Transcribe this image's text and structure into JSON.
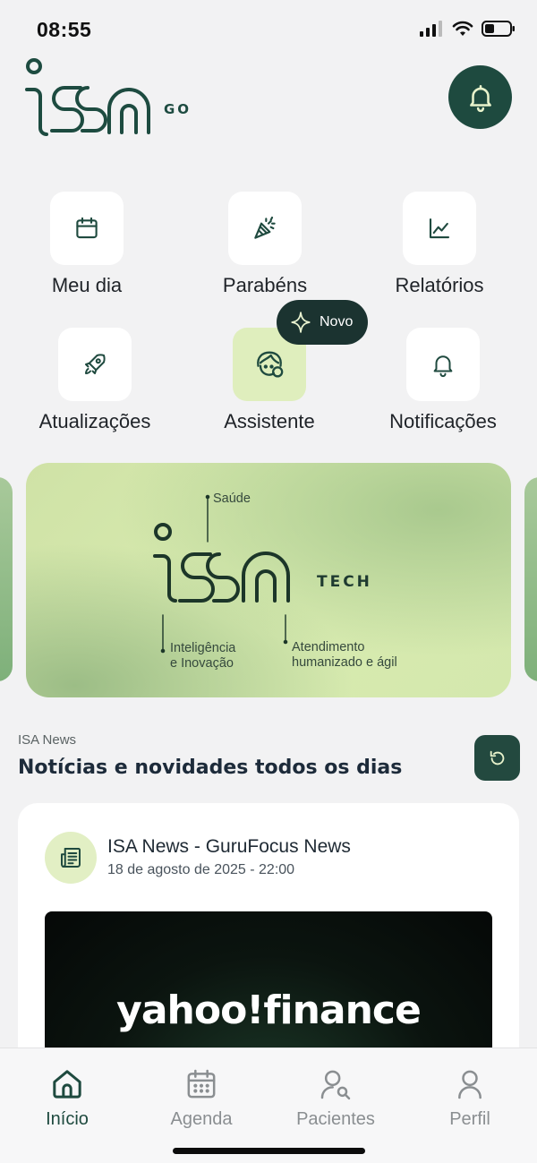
{
  "status_bar": {
    "time": "08:55"
  },
  "header": {
    "logo_text": "ISA",
    "logo_sub": "GO",
    "bell_icon": "bell-icon"
  },
  "shortcuts": [
    {
      "label": "Meu dia",
      "icon": "calendar-icon"
    },
    {
      "label": "Parabéns",
      "icon": "party-popper-icon"
    },
    {
      "label": "Relatórios",
      "icon": "chart-line-icon"
    },
    {
      "label": "Atualizações",
      "icon": "rocket-icon"
    },
    {
      "label": "Assistente",
      "icon": "assistant-face-icon"
    },
    {
      "label": "Notificações",
      "icon": "bell-icon"
    }
  ],
  "novo_badge": {
    "label": "Novo",
    "icon": "sparkle-icon"
  },
  "banner": {
    "logo_text": "ISA",
    "tech_label": "TECH",
    "label_saude": "Saúde",
    "label_inteligencia": [
      "Inteligência",
      "e Inovação"
    ],
    "label_atendimento": [
      "Atendimento",
      "humanizado e ágil"
    ]
  },
  "news": {
    "kicker": "ISA News",
    "title": "Notícias e novidades todos os dias",
    "refresh_icon": "refresh-icon",
    "card": {
      "source": "ISA News - GuruFocus News",
      "date": "18 de agosto de 2025 - 22:00",
      "image_text": "yahoo!finance"
    }
  },
  "bottom_nav": [
    {
      "label": "Início",
      "icon": "home-icon",
      "active": true
    },
    {
      "label": "Agenda",
      "icon": "calendar-grid-icon",
      "active": false
    },
    {
      "label": "Pacientes",
      "icon": "user-search-icon",
      "active": false
    },
    {
      "label": "Perfil",
      "icon": "user-icon",
      "active": false
    }
  ],
  "colors": {
    "accent": "#1e4a3f",
    "tile_green": "#dfeebd",
    "background": "#f2f2f3"
  }
}
